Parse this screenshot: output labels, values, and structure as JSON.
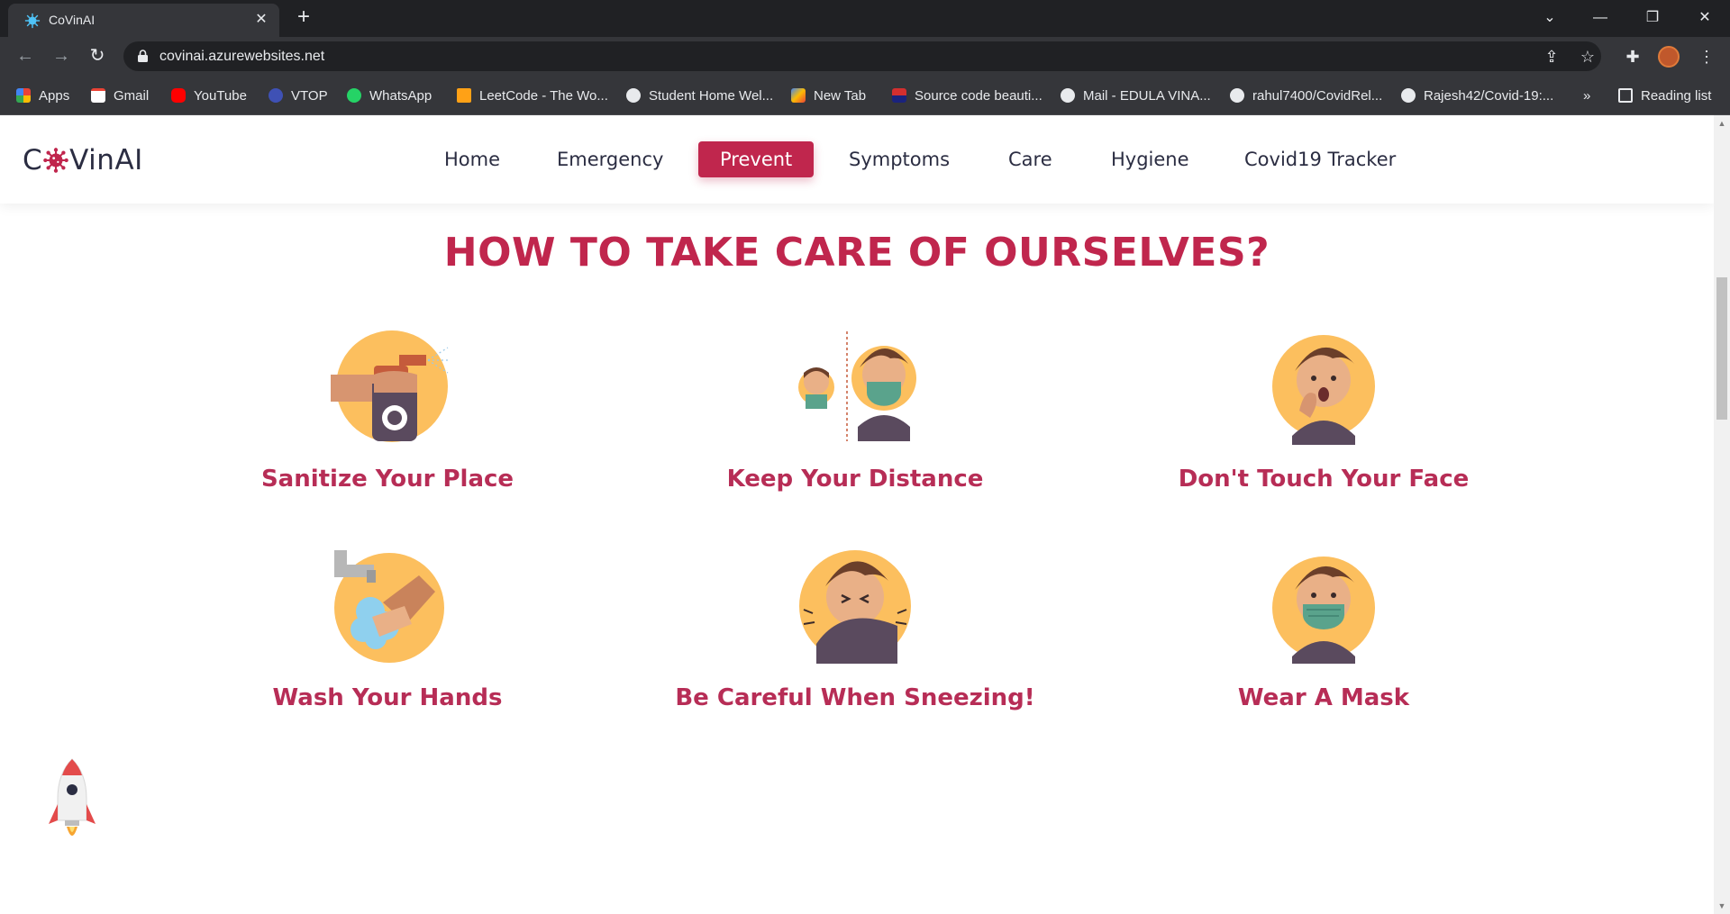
{
  "browser": {
    "tab_title": "CoVinAI",
    "tab_close": "✕",
    "new_tab": "+",
    "url": "covinai.azurewebsites.net",
    "window_controls": [
      "⌄",
      "—",
      "❐",
      "✕"
    ],
    "bookmarks": [
      {
        "label": "Apps",
        "icon": "apps-grid-icon",
        "color": "#4285f4"
      },
      {
        "label": "Gmail",
        "icon": "gmail-icon",
        "color": "#ea4335"
      },
      {
        "label": "YouTube",
        "icon": "youtube-icon",
        "color": "#ff0000"
      },
      {
        "label": "VTOP",
        "icon": "vtop-icon",
        "color": "#3f51b5"
      },
      {
        "label": "WhatsApp",
        "icon": "whatsapp-icon",
        "color": "#25d366"
      },
      {
        "label": "LeetCode - The Wo...",
        "icon": "leetcode-icon",
        "color": "#ffa116"
      },
      {
        "label": "Student Home Wel...",
        "icon": "globe-icon",
        "color": "#e8eaed"
      },
      {
        "label": "New Tab",
        "icon": "newtab-icon",
        "color": "#fbbc04"
      },
      {
        "label": "Source code beauti...",
        "icon": "source-code-icon",
        "color": "#d32f2f"
      },
      {
        "label": "Mail - EDULA VINA...",
        "icon": "globe-icon",
        "color": "#e8eaed"
      },
      {
        "label": "rahul7400/CovidRel...",
        "icon": "github-icon",
        "color": "#e8eaed"
      },
      {
        "label": "Rajesh42/Covid-19:...",
        "icon": "github-icon",
        "color": "#e8eaed"
      }
    ],
    "bookmarks_overflow": "»",
    "reading_list": "Reading list"
  },
  "site": {
    "logo_prefix": "C",
    "logo_suffix": "VinAI",
    "nav": [
      {
        "label": "Home",
        "active": false
      },
      {
        "label": "Emergency",
        "active": false
      },
      {
        "label": "Prevent",
        "active": true
      },
      {
        "label": "Symptoms",
        "active": false
      },
      {
        "label": "Care",
        "active": false
      },
      {
        "label": "Hygiene",
        "active": false
      },
      {
        "label": "Covid19 Tracker",
        "active": false
      }
    ],
    "brand_color": "#c0264d",
    "section_title": "HOW TO TAKE CARE OF OURSELVES?",
    "cards": [
      {
        "caption": "Sanitize Your Place",
        "icon": "spray-bottle-icon"
      },
      {
        "caption": "Keep Your Distance",
        "icon": "social-distance-icon"
      },
      {
        "caption": "Don't Touch Your Face",
        "icon": "touch-face-icon"
      },
      {
        "caption": "Wash Your Hands",
        "icon": "wash-hands-icon"
      },
      {
        "caption": "Be Careful When Sneezing!",
        "icon": "sneeze-icon"
      },
      {
        "caption": "Wear A Mask",
        "icon": "face-mask-icon"
      }
    ]
  }
}
